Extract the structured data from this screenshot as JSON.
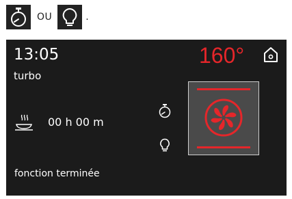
{
  "legend": {
    "or_text": "OU",
    "period": ".",
    "timer_icon": "timer-icon",
    "light_icon": "light-bulb-icon"
  },
  "display": {
    "time": "13:05",
    "mode": "turbo",
    "temperature": "160°",
    "duration": "00 h 00 m",
    "status": "fonction terminée",
    "icons": {
      "home": "home-icon",
      "dish": "dish-icon",
      "timer": "timer-icon",
      "light": "light-bulb-icon",
      "fan": "turbo-fan-icon"
    }
  },
  "colors": {
    "accent": "#e5262a",
    "screen_background": "#1b1b1b",
    "text": "#ffffff",
    "fan_panel": "#4a4a4a"
  }
}
